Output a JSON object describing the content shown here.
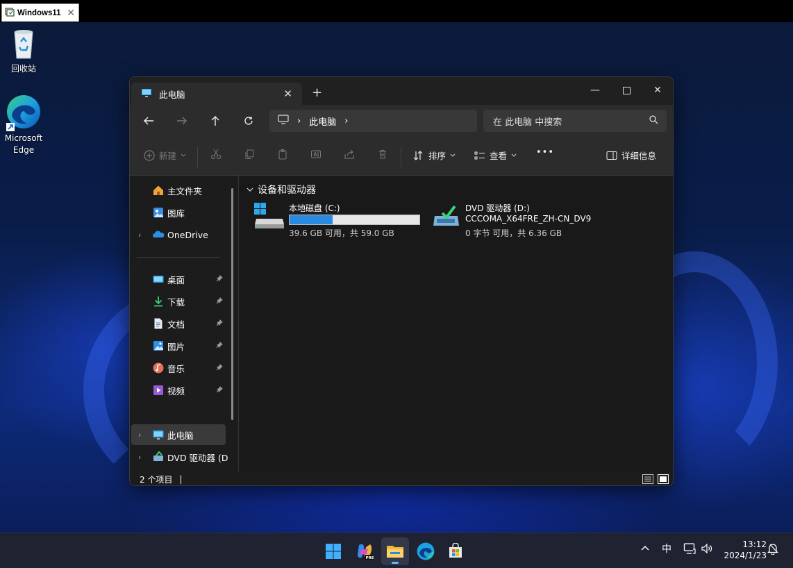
{
  "vm": {
    "tab_title": "Windows11",
    "close": "✕"
  },
  "desktop_icons": [
    {
      "label": "回收站"
    },
    {
      "label_line1": "Microsoft",
      "label_line2": "Edge"
    }
  ],
  "explorer": {
    "tab_title": "此电脑",
    "new_tab": "+",
    "window_controls": {
      "minimize": "—",
      "maximize": "☐",
      "close": "✕"
    },
    "address": {
      "segments": [
        "此电脑"
      ],
      "sep": "›"
    },
    "search_placeholder": "在 此电脑 中搜索",
    "toolbar": {
      "new_label": "新建",
      "sort_label": "排序",
      "view_label": "查看",
      "more_label": "•••",
      "details_label": "详细信息"
    },
    "sidebar": {
      "quick": [
        {
          "label": "主文件夹",
          "icon": "home-icon"
        },
        {
          "label": "图库",
          "icon": "gallery-icon"
        },
        {
          "label": "OneDrive",
          "icon": "onedrive-icon"
        }
      ],
      "pinned": [
        {
          "label": "桌面",
          "icon": "desktop-folder-icon"
        },
        {
          "label": "下载",
          "icon": "download-icon"
        },
        {
          "label": "文档",
          "icon": "document-icon"
        },
        {
          "label": "图片",
          "icon": "pictures-icon"
        },
        {
          "label": "音乐",
          "icon": "music-icon"
        },
        {
          "label": "视频",
          "icon": "video-icon"
        }
      ],
      "tree": [
        {
          "label": "此电脑",
          "icon": "this-pc-icon",
          "selected": true
        },
        {
          "label": "DVD 驱动器 (D",
          "icon": "dvd-drive-icon"
        }
      ]
    },
    "section_title": "设备和驱动器",
    "drives": [
      {
        "name": "本地磁盘 (C:)",
        "usage": "39.6 GB 可用，共 59.0 GB",
        "used_fraction": 0.33
      },
      {
        "name": "DVD 驱动器 (D:)",
        "label": "CCCOMA_X64FRE_ZH-CN_DV9",
        "usage": "0 字节 可用，共 6.36 GB"
      }
    ],
    "status": {
      "item_count": "2 个项目",
      "cursor": "|"
    }
  },
  "taskbar": {
    "tray": {
      "chevron": "^",
      "ime": "中"
    },
    "clock": {
      "time": "13:12",
      "date": "2024/1/23"
    }
  },
  "colors": {
    "accent": "#2a8ae0",
    "window_bg": "#1c1c1c",
    "taskbar_bg": "#1f2230"
  }
}
